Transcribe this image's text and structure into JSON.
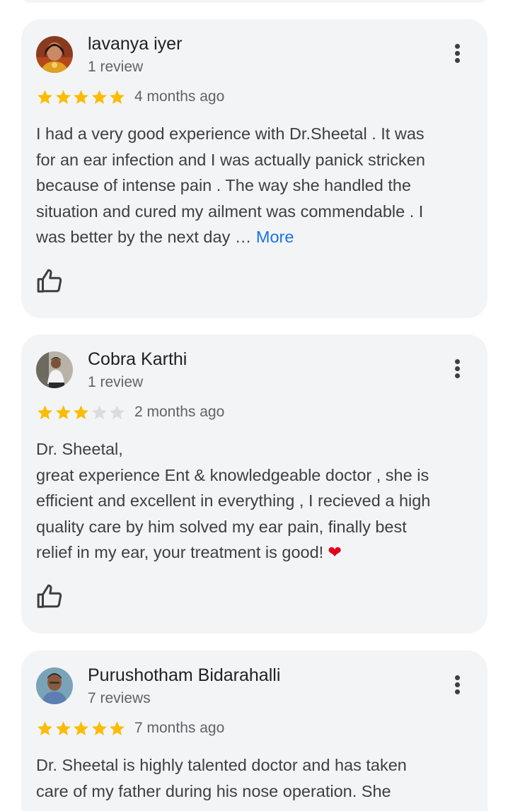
{
  "reviews": [
    {
      "author": "lavanya iyer",
      "review_count": "1 review",
      "rating": 5,
      "time_ago": "4 months ago",
      "text": "I had a very good experience with Dr.Sheetal . It was\nfor an ear infection and I was actually panick stricken\nbecause of intense pain . The way she handled the\nsituation and cured my ailment was commendable . I\nwas better by the next day",
      "truncation": " … ",
      "more_label": "More"
    },
    {
      "author": "Cobra Karthi",
      "review_count": "1 review",
      "rating": 3,
      "time_ago": "2 months ago",
      "text": "Dr. Sheetal,\ngreat experience Ent & knowledgeable doctor , she is\nefficient and excellent in everything , I recieved a high\nquality care by him solved my ear pain, finally best\nrelief in my ear, your treatment is good!",
      "emoji": "❤"
    },
    {
      "author": "Purushotham Bidarahalli",
      "review_count": "7 reviews",
      "rating": 5,
      "time_ago": "7 months ago",
      "text": "Dr. Sheetal is highly talented doctor and has taken\ncare of my father during his nose operation. She"
    }
  ],
  "colors": {
    "card_bg": "#f3f4f6",
    "star_filled": "#fbbc04",
    "star_empty": "#dadce0",
    "link": "#1a73e8",
    "heart": "#e3001b"
  },
  "icons": {
    "like": "thumbs-up-icon",
    "menu": "more-vert-icon",
    "star": "star-icon"
  }
}
